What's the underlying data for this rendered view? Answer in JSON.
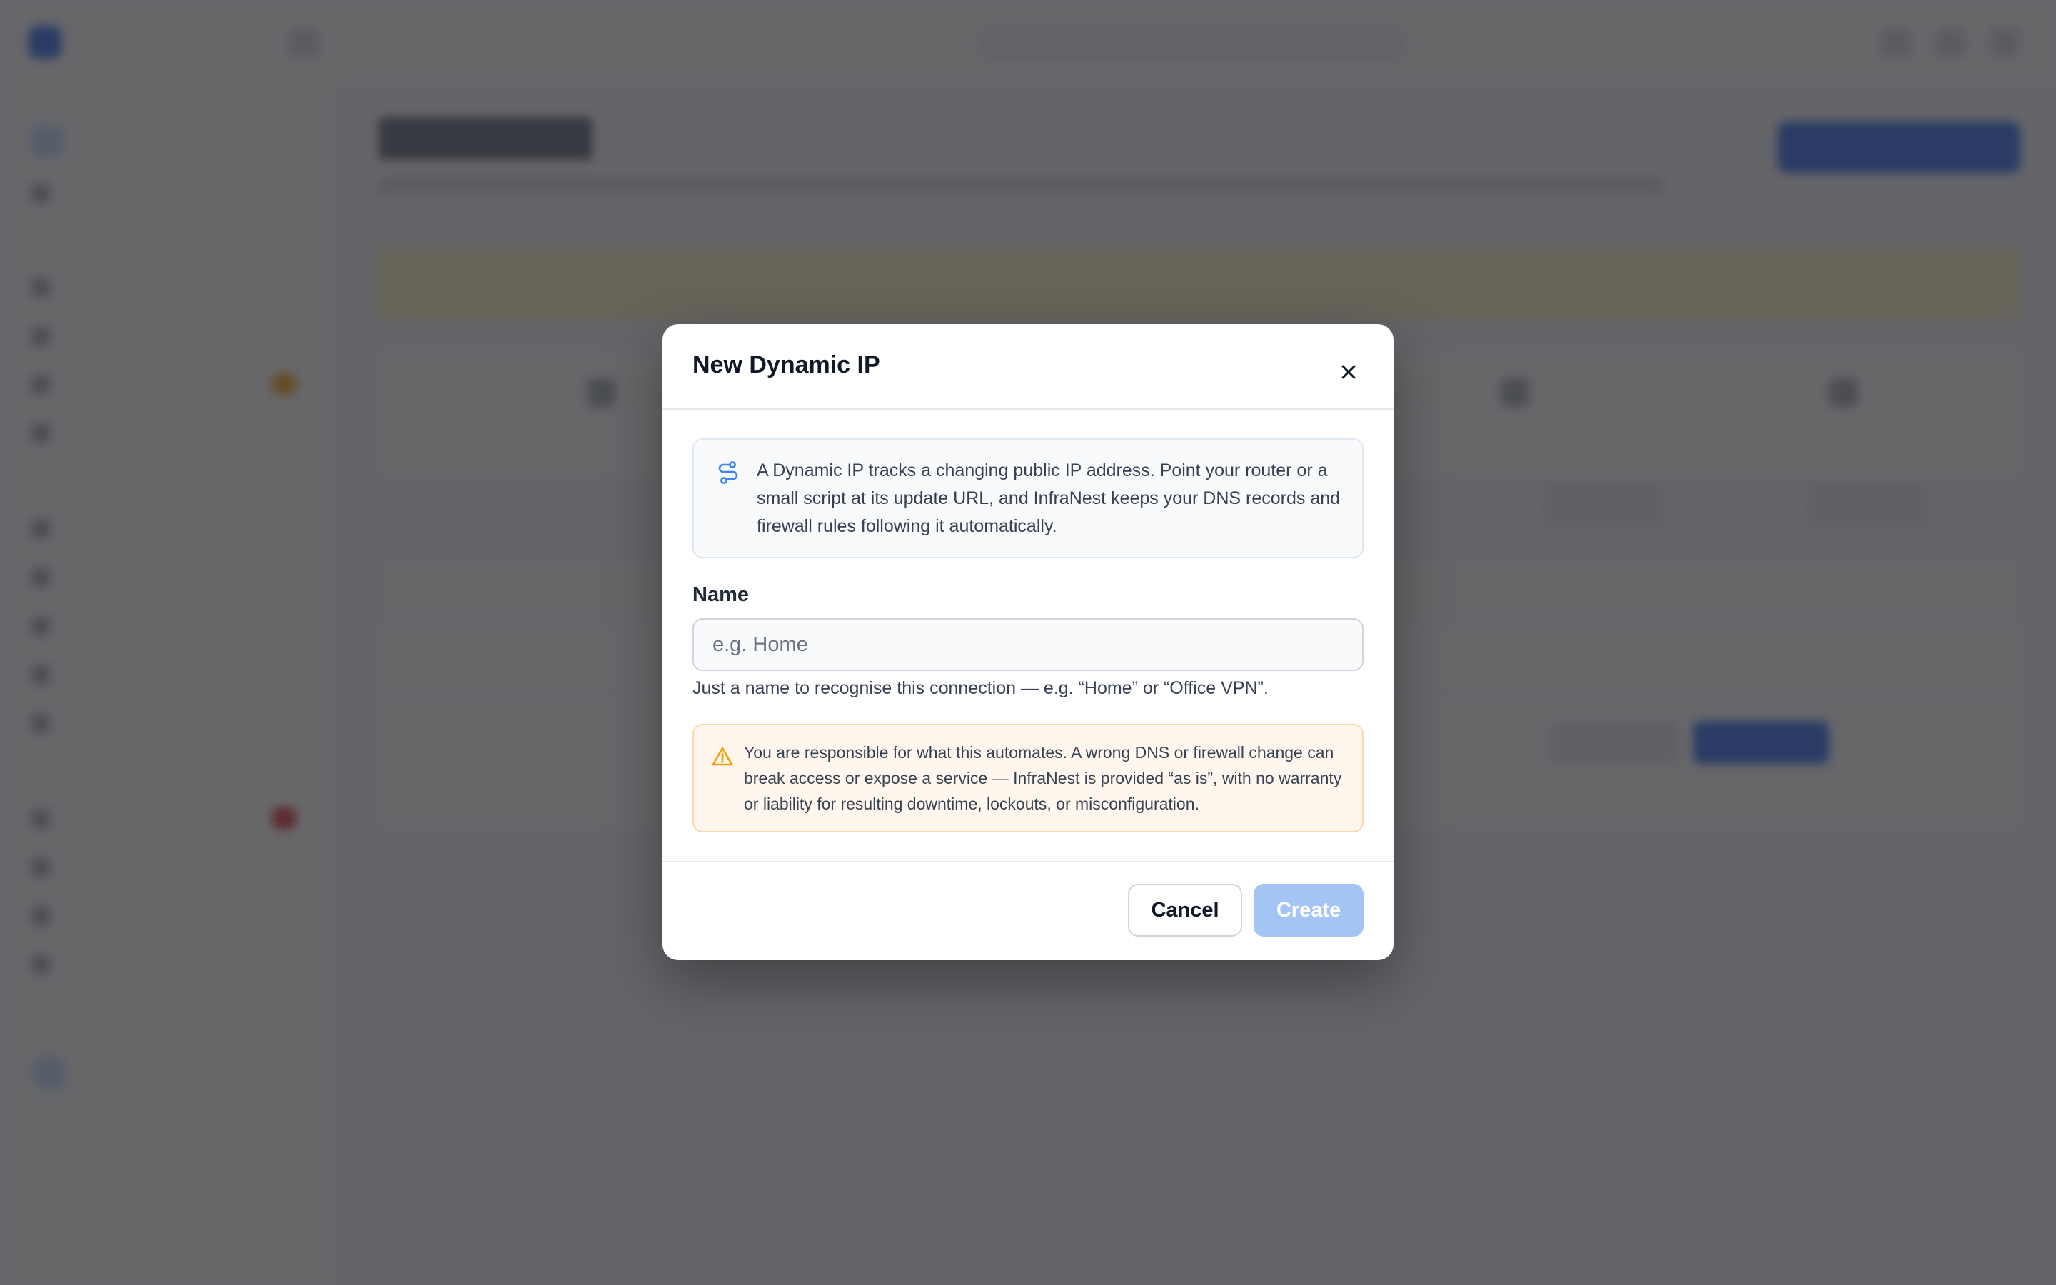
{
  "modal": {
    "title": "New Dynamic IP",
    "info_text": "A Dynamic IP tracks a changing public IP address. Point your router or a small script at its update URL, and InfraNest keeps your DNS records and firewall rules following it automatically.",
    "name_label": "Name",
    "name_placeholder": "e.g. Home",
    "name_value": "",
    "name_helper": "Just a name to recognise this connection — e.g. “Home” or “Office VPN”.",
    "warning_text": "You are responsible for what this automates. A wrong DNS or firewall change can break access or expose a service — InfraNest is provided “as is”, with no warranty or liability for resulting downtime, lockouts, or misconfiguration.",
    "cancel_label": "Cancel",
    "create_label": "Create"
  },
  "colors": {
    "accent": "#2563eb",
    "create_disabled": "#a5c4f6",
    "warning_border": "#fcd9a8",
    "warning_bg": "#fff7ed",
    "warning_icon": "#f59e0b",
    "info_icon": "#3b82f6"
  },
  "icons": {
    "close": "close-icon",
    "info": "route-icon",
    "warning": "warning-triangle-icon"
  }
}
